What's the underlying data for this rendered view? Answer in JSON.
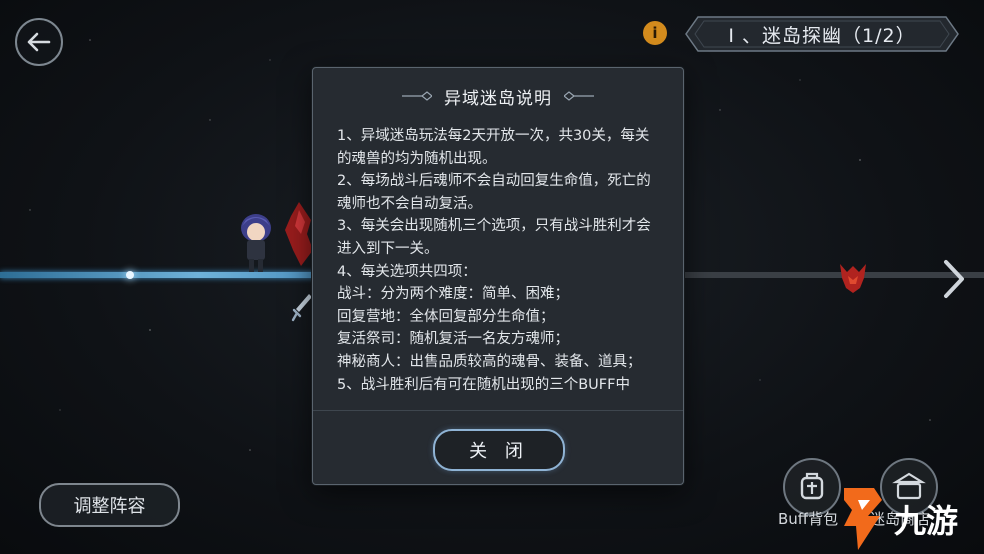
{
  "hud": {
    "stage_title": "I 、迷岛探幽（1/2）",
    "info_glyph": "i",
    "formation_button": "调整阵容",
    "buff_bag_label": "Buff背包",
    "shop_label": "迷岛商店",
    "icons": [
      "back-arrow-icon",
      "info-icon",
      "next-arrow-icon",
      "sword-icon",
      "buff-bag-icon",
      "shop-icon"
    ]
  },
  "modal": {
    "title": "异域迷岛说明",
    "lines": [
      "1、异域迷岛玩法每2天开放一次，共30关，每关的魂兽的均为随机出现。",
      "2、每场战斗后魂师不会自动回复生命值，死亡的魂师也不会自动复活。",
      "3、每关会出现随机三个选项，只有战斗胜利才会进入到下一关。",
      "4、每关选项共四项：",
      "战斗：分为两个难度：简单、困难；",
      "回复营地：全体回复部分生命值；",
      "复活祭司：随机复活一名友方魂师；",
      "神秘商人：出售品质较高的魂骨、装备、道具；",
      "5、战斗胜利后有可在随机出现的三个BUFF中"
    ],
    "close_button": "关 闭"
  },
  "watermark": {
    "text": "九游"
  },
  "colors": {
    "accent_blue": "#8fb3d4",
    "info_orange": "#d38b1d",
    "track_blue": "#6fb2da",
    "watermark_orange": "#f26a1b"
  }
}
